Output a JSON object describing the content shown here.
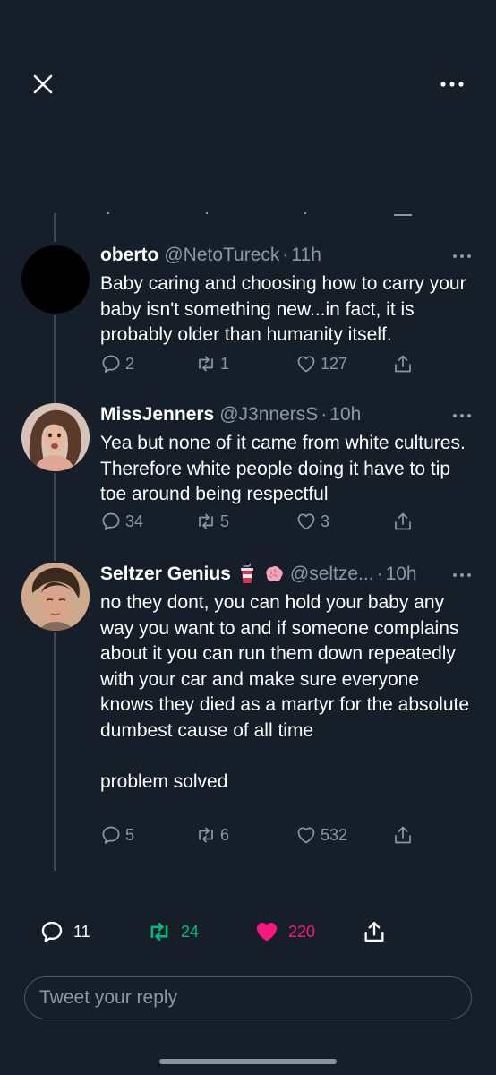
{
  "topbar": {
    "close_icon": "close-icon",
    "more_icon": "more-horizontal-icon"
  },
  "tweets": [
    {
      "name": "oberto",
      "handle": "@NetoTureck",
      "time": "11h",
      "text": "Baby caring and choosing how to carry your baby isn't something new...in fact, it is probably older than humanity itself.",
      "replies": "2",
      "retweets": "1",
      "likes": "127"
    },
    {
      "name": "MissJenners",
      "handle": "@J3nnersS",
      "time": "10h",
      "text": "Yea but none of it came from white cultures. Therefore white people doing it have to tip toe around being respectful",
      "replies": "34",
      "retweets": "5",
      "likes": "3"
    },
    {
      "name": "Seltzer Genius",
      "emojis": [
        "soda-cup-emoji",
        "brain-emoji"
      ],
      "handle": "@seltze...",
      "time": "10h",
      "text": "no they dont, you can hold your baby any way you want to and if someone complains about it you can run them down repeatedly with your car and make sure everyone knows they died as a martyr for the absolute dumbest cause of all time\n\nproblem solved",
      "replies": "5",
      "retweets": "6",
      "likes": "532"
    }
  ],
  "bottom_actions": {
    "replies": "11",
    "retweets": "24",
    "likes": "220",
    "retweet_color": "#00ba7c",
    "like_color": "#f91880"
  },
  "reply_box": {
    "placeholder": "Tweet your reply"
  }
}
